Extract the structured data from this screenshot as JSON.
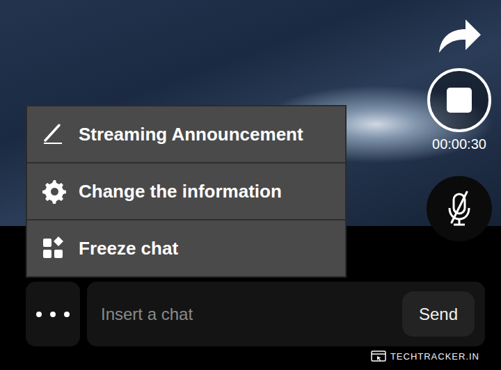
{
  "menu": {
    "items": [
      {
        "label": "Streaming Announcement"
      },
      {
        "label": "Change the information"
      },
      {
        "label": "Freeze chat"
      }
    ]
  },
  "recording": {
    "elapsed": "00:00:30"
  },
  "mic": {
    "muted": true
  },
  "chat": {
    "placeholder": "Insert a chat",
    "send": "Send"
  },
  "watermark": "TECHTRACKER.IN"
}
